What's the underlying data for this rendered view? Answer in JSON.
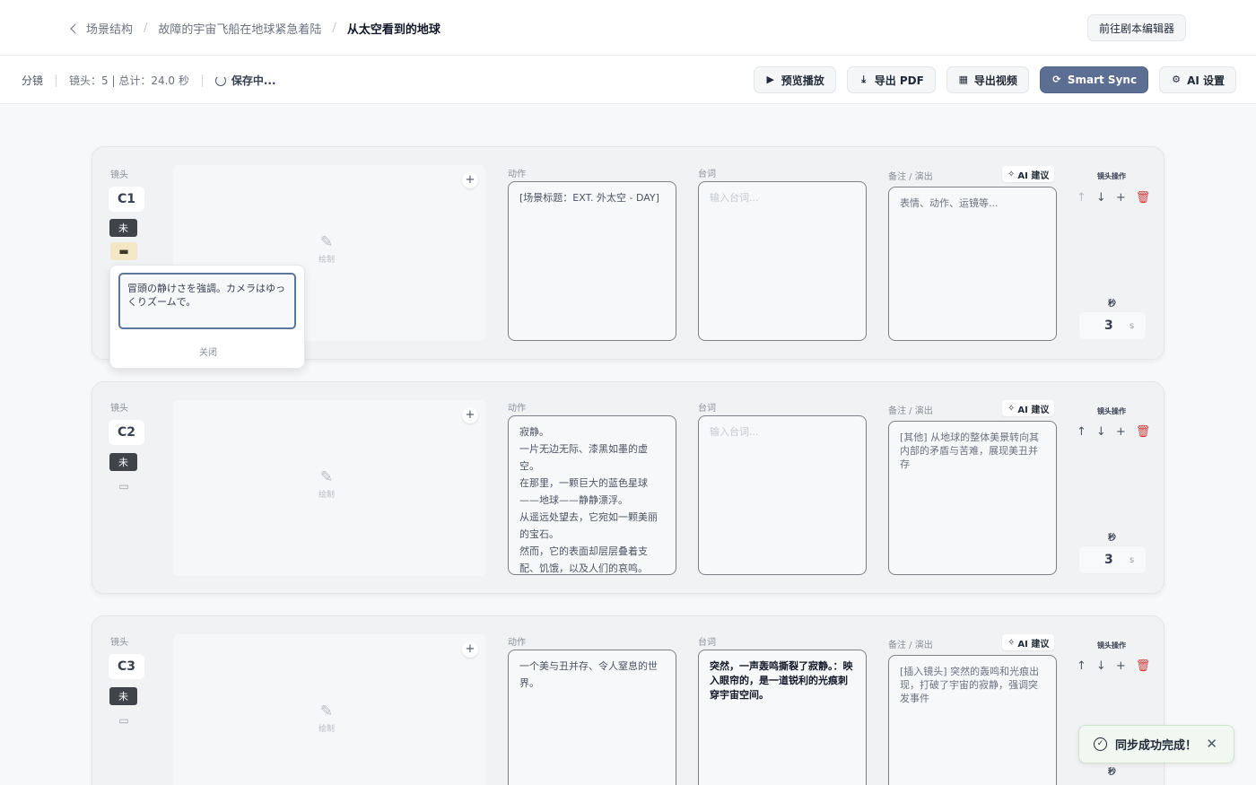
{
  "breadcrumb": {
    "items": [
      "场景结构",
      "故障的宇宙飞船在地球紧急着陆",
      "从太空看到的地球"
    ]
  },
  "header": {
    "goto_editor": "前往剧本编辑器"
  },
  "toolbar": {
    "mode": "分镜",
    "stats": "镜头：5 | 总计：24.0 秒",
    "saving": "保存中...",
    "preview": "预览播放",
    "export_pdf": "导出 PDF",
    "export_video": "导出视频",
    "smart_sync": "Smart Sync",
    "ai_settings": "AI 设置"
  },
  "labels": {
    "shot": "镜头",
    "action": "动作",
    "dialogue": "台词",
    "notes": "备注 / 演出",
    "ai_suggest": "AI 建议",
    "shot_ops": "镜头操作",
    "seconds": "秒",
    "seconds_unit": "s",
    "draw": "绘制",
    "dialogue_placeholder": "输入台词...",
    "notes_placeholder": "表情、动作、运镜等..."
  },
  "shots": [
    {
      "id": "C1",
      "status": "未",
      "action": "[场景标题：EXT. 外太空 - DAY]",
      "dialogue": "",
      "notes": "",
      "seconds": "3"
    },
    {
      "id": "C2",
      "status": "未",
      "action": "寂静。\n一片无边无际、漆黑如墨的虚空。\n在那里，一颗巨大的蓝色星球——地球——静静漂浮。\n从遥远处望去，它宛如一颗美丽的宝石。\n然而，它的表面却层层叠着支配、饥饿，以及人们的哀鸣。",
      "dialogue": "",
      "notes": "[其他] 从地球的整体美景转向其内部的矛盾与苦难，展现美丑并存",
      "seconds": "3"
    },
    {
      "id": "C3",
      "status": "未",
      "action": "一个美与丑并存、令人窒息的世界。",
      "dialogue": "突然，一声轰鸣撕裂了寂静。：映入眼帘的，是一道锐利的光痕刺穿宇宙空间。",
      "notes": "[插入镜头] 突然的轰鸣和光痕出现，打破了宇宙的寂静，强调突发事件",
      "seconds": "3"
    }
  ],
  "popover": {
    "text": "冒頭の静けさを強調。カメラはゆっくりズームで。",
    "close": "关闭"
  },
  "toast": {
    "message": "同步成功完成！"
  },
  "colors": {
    "primary": "#5c6f92",
    "danger": "#d33a3a",
    "status_tag": "#3f434a",
    "comment_active": "#f3e7c5"
  }
}
